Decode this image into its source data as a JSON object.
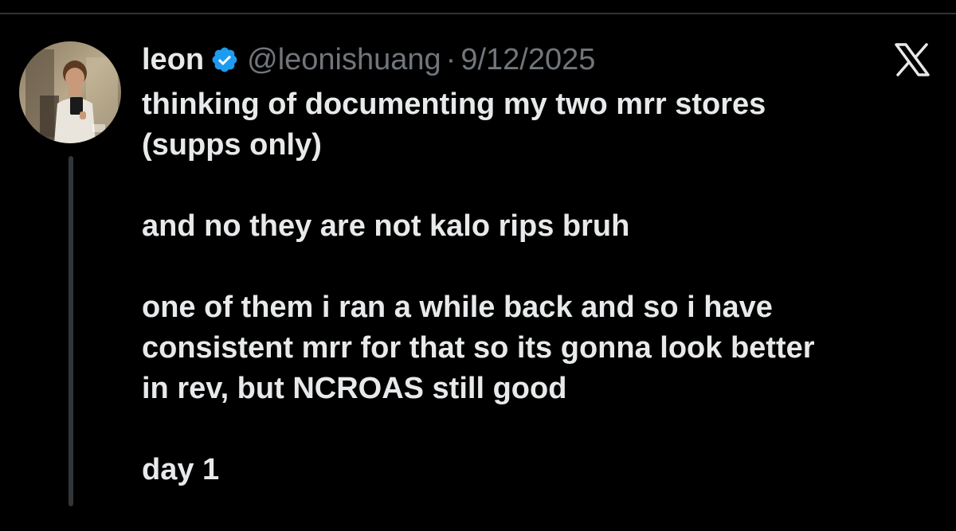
{
  "author": {
    "display_name": "leon",
    "handle": "@leonishuang",
    "separator": "·",
    "date": "9/12/2025",
    "avatar_icon": "profile-photo-avatar",
    "verified_icon": "verified-badge-icon",
    "verified_color": "#1d9bf0"
  },
  "platform": {
    "logo_icon": "x-logo-icon"
  },
  "tweet": {
    "paragraphs": [
      {
        "lines": [
          "thinking of documenting my two mrr stores",
          "(supps only)"
        ]
      },
      {
        "lines": [
          "and no they are not kalo rips bruh"
        ]
      },
      {
        "lines": [
          "one of them i ran a while back and so i have",
          "consistent mrr for that so its gonna look better",
          "in rev, but NCROAS still good"
        ]
      },
      {
        "lines": [
          "day 1"
        ]
      }
    ]
  },
  "colors": {
    "background": "#000000",
    "primary_text": "#e7e9ea",
    "secondary_text": "#71767b",
    "thread_line": "#333639",
    "divider": "#2f3336"
  }
}
